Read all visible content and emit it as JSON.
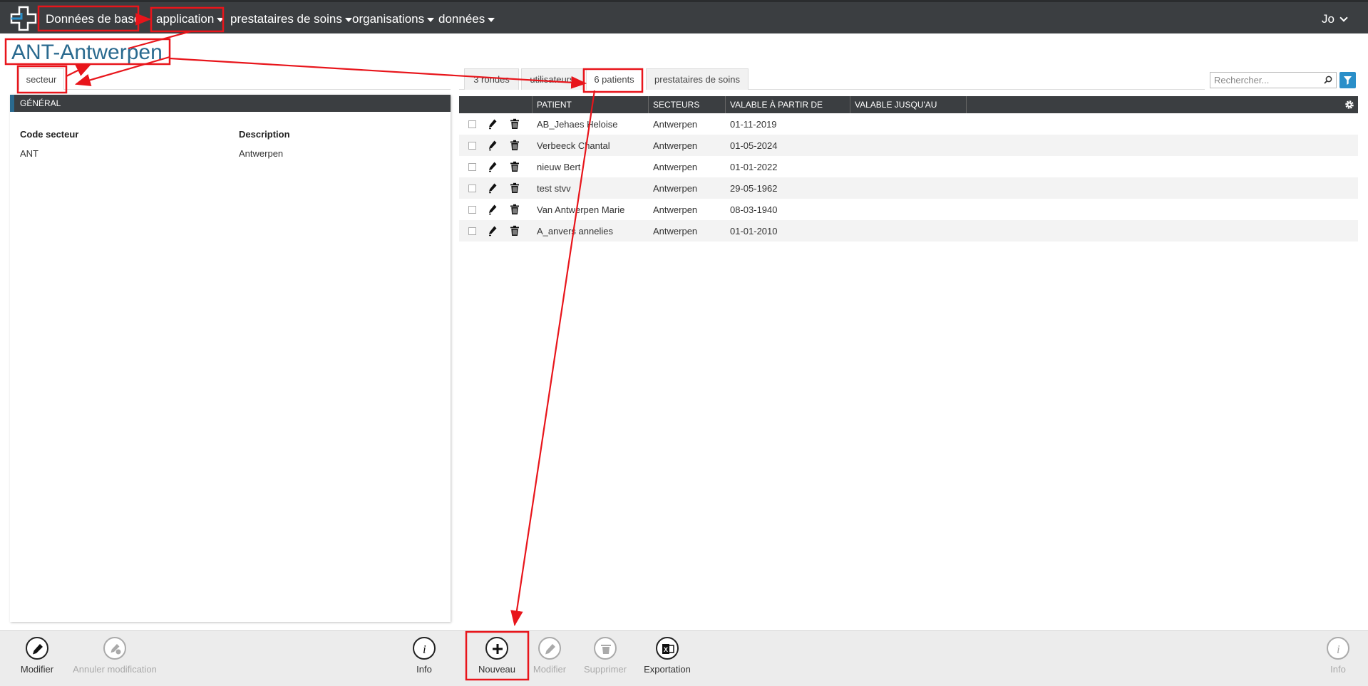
{
  "nav": {
    "items": [
      {
        "label": "Données de base",
        "has_caret": false
      },
      {
        "label": "application",
        "has_caret": true
      },
      {
        "label": "prestataires de soins",
        "has_caret": true
      },
      {
        "label": "organisations",
        "has_caret": true
      },
      {
        "label": "données",
        "has_caret": true
      }
    ],
    "user": "Jo"
  },
  "page": {
    "title": "ANT-Antwerpen"
  },
  "left_tabs": [
    {
      "label": "secteur",
      "active": true
    }
  ],
  "right_tabs": [
    {
      "label": "3 rondes",
      "active": false
    },
    {
      "label": "utilisateurs",
      "active": false
    },
    {
      "label": "6 patients",
      "active": true
    },
    {
      "label": "prestataires de soins",
      "active": false
    }
  ],
  "general": {
    "header": "GÉNÉRAL",
    "fields": [
      {
        "label": "Code secteur",
        "value": "ANT"
      },
      {
        "label": "Description",
        "value": "Antwerpen"
      }
    ]
  },
  "search": {
    "placeholder": "Rechercher..."
  },
  "grid": {
    "columns": [
      "PATIENT",
      "SECTEURS",
      "VALABLE À PARTIR DE",
      "VALABLE JUSQU'AU"
    ],
    "rows": [
      {
        "patient": "AB_Jehaes Heloise",
        "secteur": "Antwerpen",
        "from": "01-11-2019",
        "to": ""
      },
      {
        "patient": "Verbeeck Chantal",
        "secteur": "Antwerpen",
        "from": "01-05-2024",
        "to": ""
      },
      {
        "patient": "nieuw Bert",
        "secteur": "Antwerpen",
        "from": "01-01-2022",
        "to": ""
      },
      {
        "patient": "test stvv",
        "secteur": "Antwerpen",
        "from": "29-05-1962",
        "to": ""
      },
      {
        "patient": "Van Antwerpen Marie",
        "secteur": "Antwerpen",
        "from": "08-03-1940",
        "to": ""
      },
      {
        "patient": "A_anvers annelies",
        "secteur": "Antwerpen",
        "from": "01-01-2010",
        "to": ""
      }
    ]
  },
  "toolbar": {
    "left": [
      {
        "label": "Modifier",
        "icon": "pencil-icon",
        "enabled": true
      },
      {
        "label": "Annuler modification",
        "icon": "undo-edit-icon",
        "enabled": false
      }
    ],
    "center": [
      {
        "label": "Info",
        "icon": "info-icon",
        "enabled": true
      },
      {
        "label": "Nouveau",
        "icon": "plus-icon",
        "enabled": true
      },
      {
        "label": "Modifier",
        "icon": "pencil-icon",
        "enabled": false
      },
      {
        "label": "Supprimer",
        "icon": "trash-icon",
        "enabled": false
      },
      {
        "label": "Exportation",
        "icon": "excel-icon",
        "enabled": true
      }
    ],
    "right": [
      {
        "label": "Info",
        "icon": "info-icon",
        "enabled": false
      }
    ]
  },
  "colors": {
    "topbar": "#3b3e41",
    "accent": "#2a6a8f",
    "annotation": "#e8151b",
    "filter": "#2a8fc9"
  }
}
